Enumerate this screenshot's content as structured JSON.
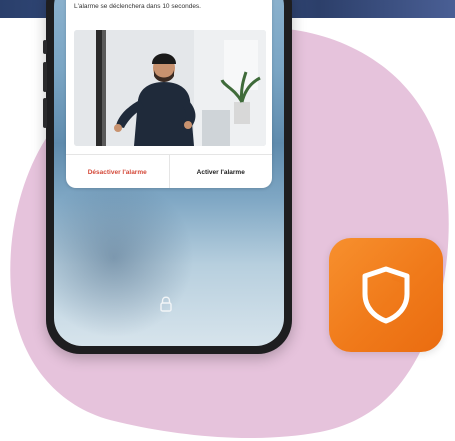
{
  "notification": {
    "message": "L'alarme se déclenchera dans 10 secondes.",
    "disable_label": "Désactiver l'alarme",
    "enable_label": "Activer l'alarme"
  },
  "colors": {
    "blob": "#e6c3dc",
    "app_icon": "#f28522",
    "disable_text": "#d44a3a"
  },
  "icons": {
    "app": "shield-icon",
    "lock": "lock-icon"
  }
}
